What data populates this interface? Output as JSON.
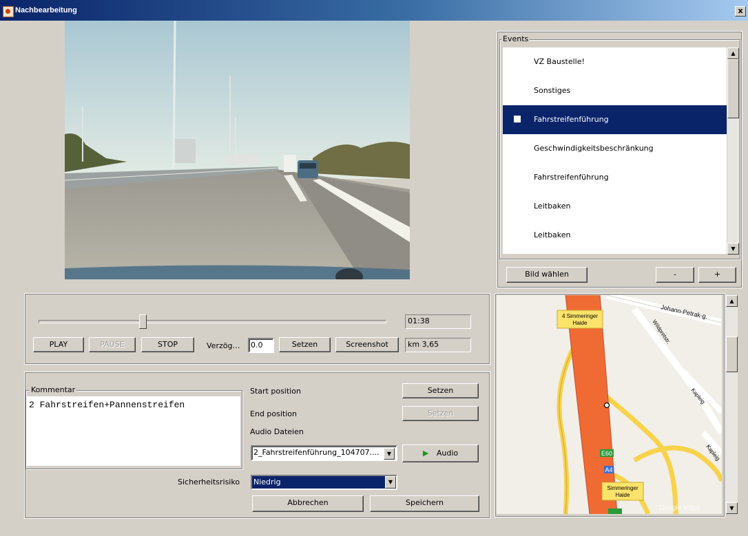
{
  "window": {
    "title": "Nachbearbeitung",
    "close_glyph": "x"
  },
  "player": {
    "time": "01:38",
    "km": "km 3,65",
    "slider_position_fraction": 0.3,
    "buttons": {
      "play": "PLAY",
      "pause": "PAUSE",
      "stop": "STOP",
      "set": "Setzen",
      "screenshot": "Screenshot"
    },
    "delay_label": "Verzög…",
    "delay_value": "0.0"
  },
  "comment": {
    "legend": "Kommentar",
    "text": "2 Fahrstreifen+Pannenstreifen",
    "start_position_label": "Start position",
    "end_position_label": "End position",
    "audio_files_label": "Audio Dateien",
    "set_start": "Setzen",
    "set_end": "Setzen",
    "audio_file": "2_Fahrstreifenführung_104707....",
    "audio_button": "Audio",
    "risk_label": "Sicherheitsrisiko",
    "risk_value": "Niedrig",
    "cancel": "Abbrechen",
    "save": "Speichern"
  },
  "events": {
    "legend": "Events",
    "items": [
      {
        "label": "VZ Baustelle!",
        "selected": false
      },
      {
        "label": "Sonstiges",
        "selected": false
      },
      {
        "label": "Fahrstreifenführung",
        "selected": true
      },
      {
        "label": "Geschwindigkeitsbeschränkung",
        "selected": false
      },
      {
        "label": "Fahrstreifenführung",
        "selected": false
      },
      {
        "label": "Leitbaken",
        "selected": false
      },
      {
        "label": "Leitbaken",
        "selected": false
      }
    ],
    "choose_image": "Bild wählen",
    "minus": "-",
    "plus": "+"
  },
  "map": {
    "labels": {
      "station1": "4 Simmeringer Haide",
      "station1_l1": "4 Simmeringer",
      "station1_l2": "Haide",
      "station2_l1": "Simmeringer",
      "station2_l2": "Haide",
      "street1": "Johann-Petrak-g.",
      "street2": "Wildpretstr.",
      "street3": "Kapleig",
      "street4": "Kapleig",
      "road_e60": "E60",
      "road_a4": "A4",
      "road_e60b": "E60",
      "watermark": "Google Maps"
    },
    "colors": {
      "highway": "#f06a34",
      "road": "#f8d24a",
      "shield": "#2a9a3a",
      "a_shield": "#3b6fd4"
    }
  }
}
